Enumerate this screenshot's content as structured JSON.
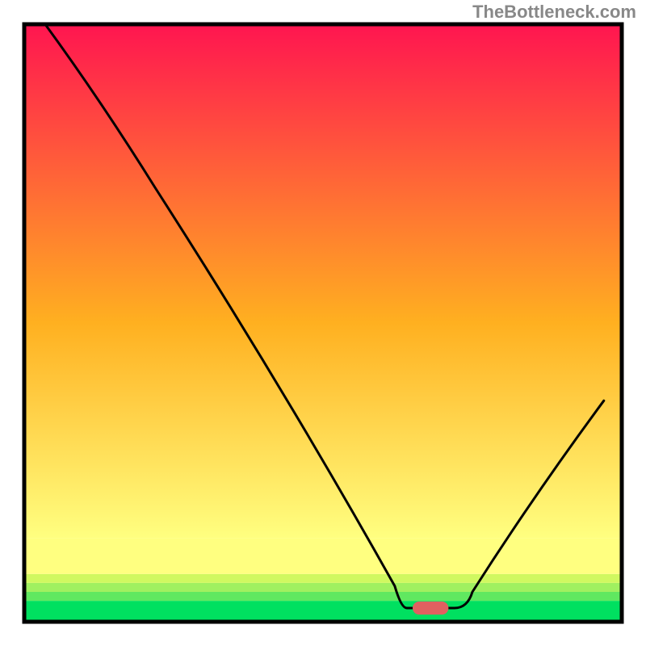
{
  "watermark": "TheBottleneck.com",
  "chart_data": {
    "type": "line",
    "title": "",
    "xlabel": "",
    "ylabel": "",
    "xlim": [
      0,
      100
    ],
    "ylim": [
      0,
      100
    ],
    "gradient_bands": [
      {
        "color": "#00e060",
        "y0": 0,
        "y1": 3.5
      },
      {
        "color": "#60e860",
        "y0": 3.5,
        "y1": 5
      },
      {
        "color": "#a0f060",
        "y0": 5,
        "y1": 6.5
      },
      {
        "color": "#d0f860",
        "y0": 6.5,
        "y1": 8
      },
      {
        "color": "#ffff80",
        "y0": 8,
        "y1": 14
      }
    ],
    "gradient_top": {
      "y": 100,
      "color": "#ff1550"
    },
    "gradient_mid": {
      "y": 50,
      "color": "#ffb020"
    },
    "gradient_yellow": {
      "y": 14,
      "color": "#ffff80"
    },
    "curve": [
      {
        "x": 3.5,
        "y": 100
      },
      {
        "x": 22,
        "y": 72.5
      },
      {
        "x": 62,
        "y": 6
      },
      {
        "x": 64,
        "y": 2.3
      },
      {
        "x": 72,
        "y": 2.3
      },
      {
        "x": 75,
        "y": 5
      },
      {
        "x": 97,
        "y": 37
      }
    ],
    "marker": {
      "x": 68,
      "y": 2.3,
      "width": 6,
      "height": 2.2,
      "color": "#e06060"
    }
  }
}
